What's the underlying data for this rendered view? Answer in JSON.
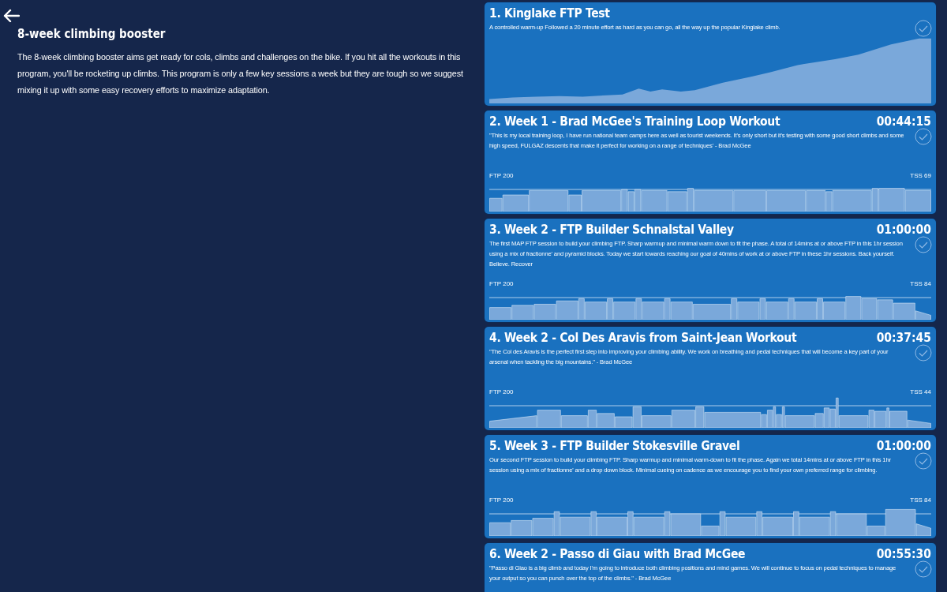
{
  "program": {
    "title": "8-week climbing booster",
    "description": "The 8-week climbing booster aims get ready for cols, climbs and challenges on the bike. If you hit all the workouts in this program, you'll be rocketing up climbs. This program is only a few key sessions a week but they are tough so we suggest mixing it up with some easy recovery efforts to maximize adaptation."
  },
  "workouts": [
    {
      "title": "1. Kinglake FTP Test",
      "description": "A controlled warm-up Followed a 20 minute effort as hard as you can go, all the way up the popular Kinglake climb.",
      "profile": {
        "kind": "elevation"
      }
    },
    {
      "title": "2. Week 1 - Brad McGee's Training Loop Workout",
      "duration": "00:44:15",
      "description": "\"This is my local training loop, I have run national team camps here as well as tourist weekends. It's only short but it's testing with some good short climbs and some high speed, FULGAZ descents that make it perfect for working on a range of techniques' - Brad McGee",
      "profile": {
        "kind": "power",
        "ftp_label": "FTP 200",
        "tss_label": "TSS 69"
      }
    },
    {
      "title": "3. Week 2 - FTP Builder Schnalstal Valley",
      "duration": "01:00:00",
      "description": "The first MAP FTP session to build your climbing FTP. Sharp warmup and minimal warm down to fit the phase. A total of 14mins at or above FTP in this 1hr session using a mix of fractionne' and pyramid blocks. Today we start towards reaching our goal of 40mins of work at or above FTP in these 1hr sessions. Back yourself. Believe. Recover",
      "profile": {
        "kind": "power",
        "ftp_label": "FTP 200",
        "tss_label": "TSS 84"
      }
    },
    {
      "title": "4. Week 2 - Col Des Aravis from Saint-Jean Workout",
      "duration": "00:37:45",
      "description": "\"The Col des Aravis is the perfect first step into improving your climbing ability. We work on breathing and pedal techniques that will become a key part of your arsenal when tackling the big mountains.\" - Brad McGee",
      "profile": {
        "kind": "power",
        "ftp_label": "FTP 200",
        "tss_label": "TSS 44"
      }
    },
    {
      "title": "5. Week 3 - FTP Builder Stokesville Gravel",
      "duration": "01:00:00",
      "description": "Our second FTP session to build your climbing FTP. Sharp warmup and minimal warm-down to fit the phase. Again we total 14mins at or above FTP in this 1hr session using a mix of fractionne' and a drop down block. Minimal cueing on cadence as we encourage you to find your own preferred range for climbing.",
      "profile": {
        "kind": "power",
        "ftp_label": "FTP 200",
        "tss_label": "TSS 84"
      }
    },
    {
      "title": "6. Week 2 - Passo di Giau with Brad McGee",
      "duration": "00:55:30",
      "description": "\"Passo di Giao is a big climb and today I'm going to introduce both climbing positions and mind games. We will continue to focus on pedal techniques to manage your output so you can punch over the top of the climbs.\" - Brad McGee"
    }
  ]
}
